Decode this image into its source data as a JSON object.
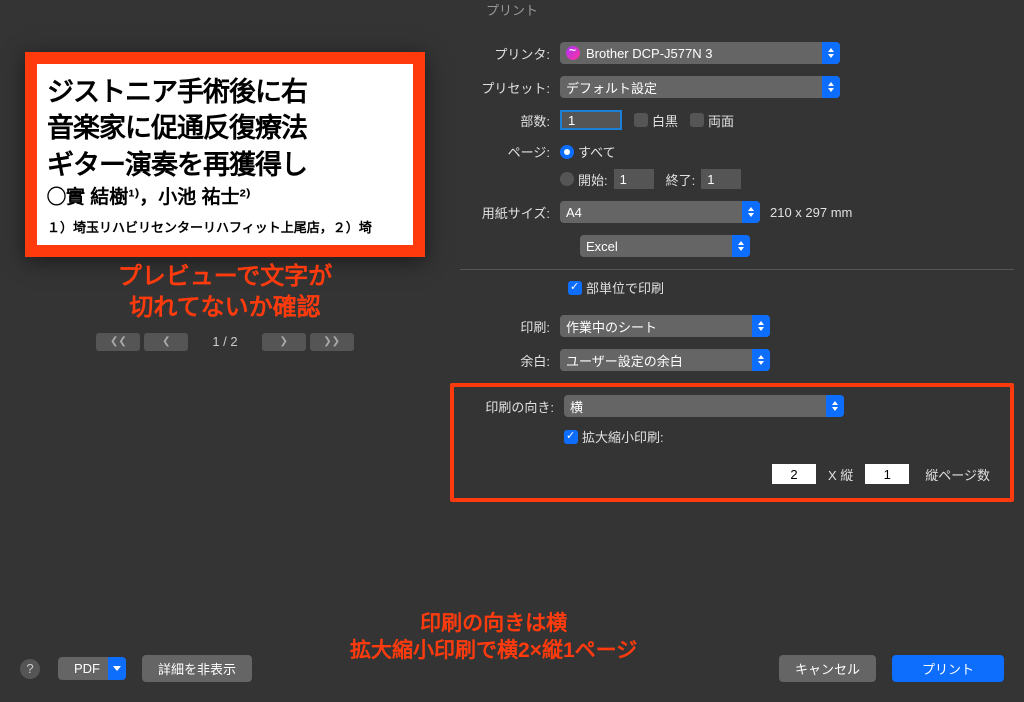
{
  "title": "プリント",
  "preview": {
    "l1": "ジストニア手術後に右",
    "l2": "音楽家に促通反復療法",
    "l3": "ギター演奏を再獲得し",
    "l4": "◯實 結樹¹⁾，小池 祐士²⁾",
    "l5": "１）埼玉リハビリセンターリハフィット上尾店，２）埼"
  },
  "annotation1_line1": "プレビューで文字が",
  "annotation1_line2": "切れてないか確認",
  "pager": {
    "count": "1 / 2"
  },
  "labels": {
    "printer": "プリンタ:",
    "preset": "プリセット:",
    "copies": "部数:",
    "pages": "ページ:",
    "paper": "用紙サイズ:",
    "print_section": "印刷:",
    "margin": "余白:",
    "orientation": "印刷の向き:",
    "bw": "白黒",
    "duplex": "両面",
    "all": "すべて",
    "from": "開始:",
    "to": "終了:",
    "collate": "部単位で印刷",
    "scale": "拡大縮小印刷:",
    "x_vert": "X 縦",
    "pages_tall": "縦ページ数"
  },
  "values": {
    "printer": "Brother DCP-J577N 3",
    "preset": "デフォルト設定",
    "copies": "1",
    "from": "1",
    "to": "1",
    "paper": "A4",
    "paper_dim": "210 x 297 mm",
    "app": "Excel",
    "print_section": "作業中のシート",
    "margin": "ユーザー設定の余白",
    "orientation": "横",
    "wide": "2",
    "tall": "1"
  },
  "annotation2_line1": "印刷の向きは横",
  "annotation2_line2": "拡大縮小印刷で横2×縦1ページ",
  "footer": {
    "pdf": "PDF",
    "details": "詳細を非表示",
    "cancel": "キャンセル",
    "print": "プリント"
  }
}
